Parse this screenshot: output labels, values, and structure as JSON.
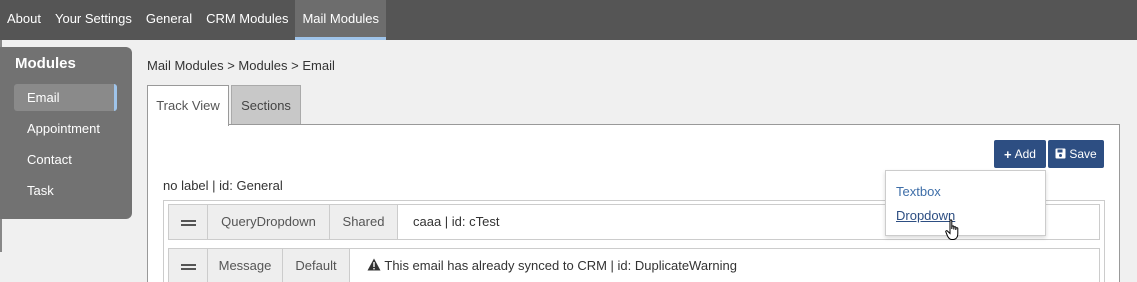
{
  "topnav": {
    "items": [
      {
        "label": "About"
      },
      {
        "label": "Your Settings"
      },
      {
        "label": "General"
      },
      {
        "label": "CRM Modules"
      },
      {
        "label": "Mail Modules",
        "active": true
      }
    ]
  },
  "sidebar": {
    "title": "Modules",
    "items": [
      {
        "label": "Email",
        "active": true
      },
      {
        "label": "Appointment"
      },
      {
        "label": "Contact"
      },
      {
        "label": "Task"
      }
    ]
  },
  "breadcrumb": "Mail Modules > Modules > Email",
  "tabs": [
    {
      "label": "Track View",
      "active": true
    },
    {
      "label": "Sections"
    }
  ],
  "toolbar": {
    "add_label": "Add",
    "save_label": "Save"
  },
  "section": {
    "label": "no label | id: General"
  },
  "rows": [
    {
      "type": "QueryDropdown",
      "mode": "Shared",
      "text": "caaa | id: cTest"
    },
    {
      "type": "Message",
      "mode": "Default",
      "text": "This email has already synced to CRM | id: DuplicateWarning"
    }
  ],
  "dropdown": {
    "options": [
      {
        "label": "Textbox"
      },
      {
        "label": "Dropdown"
      }
    ]
  },
  "colors": {
    "nav_bg": "#555555",
    "accent": "#9fc4ea",
    "button": "#2d4e82",
    "link": "#3e6ea8"
  }
}
